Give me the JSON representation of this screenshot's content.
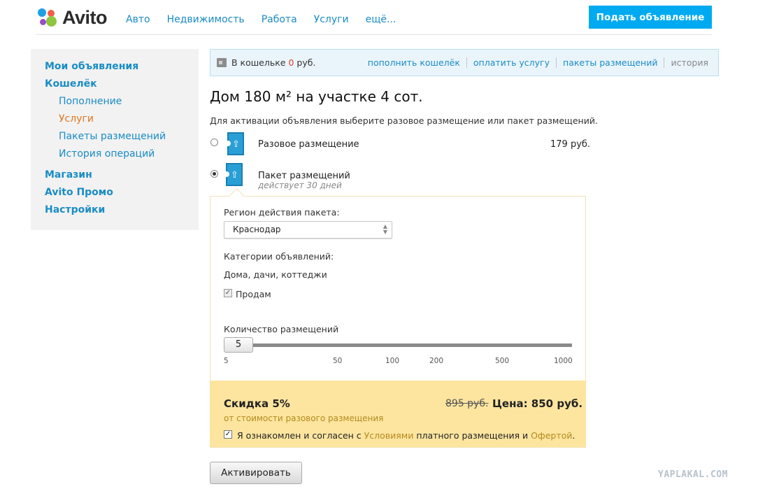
{
  "header": {
    "logo_text": "Avito",
    "nav": [
      "Авто",
      "Недвижимость",
      "Работа",
      "Услуги",
      "ещё..."
    ],
    "post_button": "Подать объявление"
  },
  "sidebar": {
    "my_ads": "Мои объявления",
    "wallet": "Кошелёк",
    "wallet_sub": [
      "Пополнение",
      "Услуги",
      "Пакеты размещений",
      "История операций"
    ],
    "shop": "Магазин",
    "promo": "Avito Промо",
    "settings": "Настройки"
  },
  "wallet_bar": {
    "prefix": "В кошельке",
    "amount": "0",
    "currency": "руб.",
    "links": [
      "пополнить кошелёк",
      "оплатить услугу",
      "пакеты размещений",
      "история"
    ]
  },
  "main": {
    "title": "Дом 180 м² на участке 4 сот.",
    "instruction": "Для активации объявления выберите разовое размещение или пакет размещений.",
    "option_single": {
      "label": "Разовое размещение",
      "price": "179 руб."
    },
    "option_package": {
      "label": "Пакет размещений",
      "sub": "действует 30 дней"
    }
  },
  "package": {
    "region_label": "Регион действия пакета:",
    "region_value": "Краснодар",
    "categories_label": "Категории объявлений:",
    "category": "Дома, дачи, коттеджи",
    "sell_label": "Продам",
    "count_label": "Количество размещений",
    "slider_value": "5",
    "ticks": [
      "5",
      "50",
      "100",
      "200",
      "500",
      "1000"
    ]
  },
  "discount": {
    "title": "Скидка 5%",
    "subtitle": "от стоимости разового размещения",
    "old_price": "895 руб.",
    "new_price": "Цена: 850 руб.",
    "agree_prefix": "Я ознакомлен и согласен с",
    "agree_link1": "Условиями",
    "agree_mid": "платного размещения и",
    "agree_link2": "Офертой",
    "agree_end": "."
  },
  "activate_button": "Активировать",
  "watermark": "YAPLAKAL.COM"
}
